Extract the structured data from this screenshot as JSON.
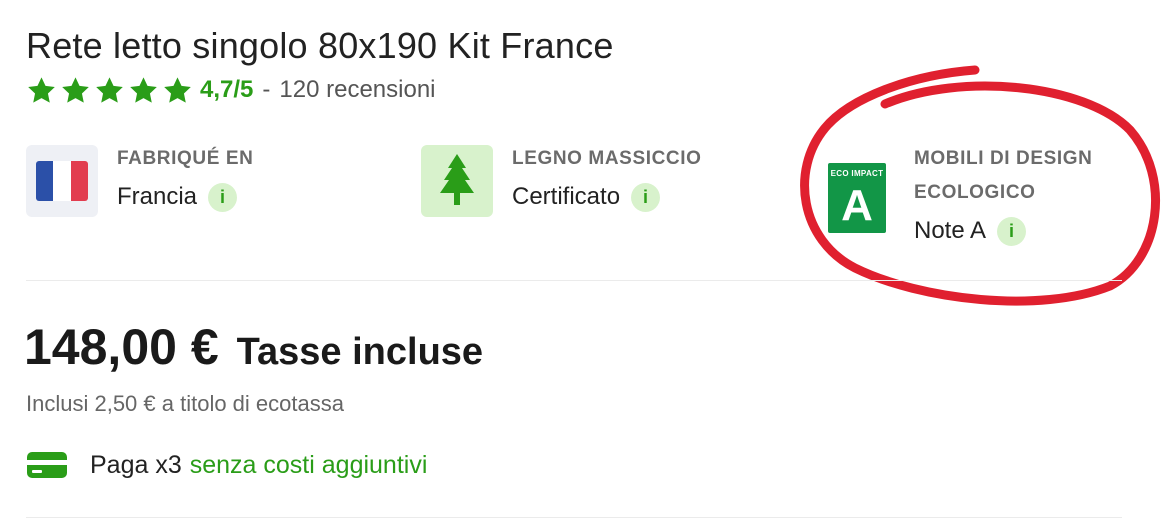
{
  "product": {
    "title": "Rete letto singolo 80x190 Kit France",
    "rating": {
      "stars": 5,
      "score": "4,7/5",
      "separator": "-",
      "reviews": "120 recensioni"
    }
  },
  "features": [
    {
      "label": "FABRIQUÉ EN",
      "value": "Francia",
      "info": "i",
      "icon": "france-flag-icon"
    },
    {
      "label": "LEGNO MASSICCIO",
      "value": "Certificato",
      "info": "i",
      "icon": "tree-icon"
    },
    {
      "label_line1": "MOBILI DI DESIGN",
      "label_line2": "ECOLOGICO",
      "value": "Note A",
      "info": "i",
      "icon": "eco-impact-badge-icon",
      "badge_top": "ECO IMPACT",
      "badge_grade": "A"
    }
  ],
  "pricing": {
    "price": "148,00 €",
    "tax_note": "Tasse incluse",
    "ecotax": "Inclusi 2,50 € a titolo di ecotassa"
  },
  "payment": {
    "label": "Paga x3",
    "extra": "senza costi aggiuntivi",
    "icon": "credit-card-icon"
  },
  "colors": {
    "accent_green": "#2a9d18",
    "info_bg": "#d8f2cc",
    "annotation_red": "#e0202f",
    "eco_badge_green": "#129647"
  }
}
